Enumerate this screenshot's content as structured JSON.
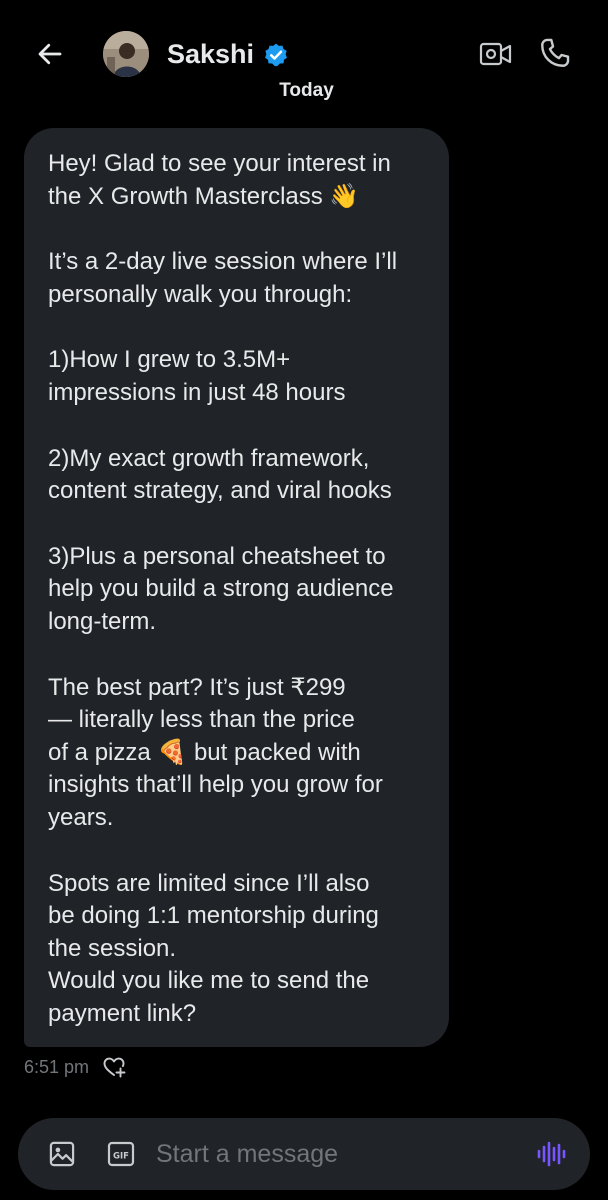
{
  "header": {
    "contact_name": "Sakshi",
    "icons": {
      "back": "arrow-left-icon",
      "verified": "verified-badge-icon",
      "video": "video-call-icon",
      "phone": "phone-icon"
    }
  },
  "date_separator": "Today",
  "message": {
    "paragraphs": [
      "Hey! Glad to see your interest in\nthe X Growth Masterclass 👋",
      "It’s a 2-day live session where I’ll\npersonally walk you through:",
      "1)How I grew to 3.5M+\nimpressions in just 48 hours",
      "2)My exact growth framework,\ncontent strategy, and viral hooks",
      "3)Plus a personal cheatsheet to\nhelp you build a strong audience\nlong-term.",
      "The best part? It’s just ₹299\n— literally less than the price\nof a pizza 🍕 but packed with\ninsights that’ll help you grow for\nyears.",
      "Spots are limited since I’ll also\nbe doing 1:1 mentorship during\nthe session.\nWould you like me to send the\npayment link?"
    ],
    "time": "6:51 pm"
  },
  "composer": {
    "placeholder": "Start a message",
    "value": "",
    "gif_label": "GIF"
  },
  "colors": {
    "background": "#000000",
    "bubble": "#202327",
    "text": "#e7e9ea",
    "muted": "#71767b",
    "verified": "#1d9bf0",
    "voice_accent": "#7856ff"
  }
}
